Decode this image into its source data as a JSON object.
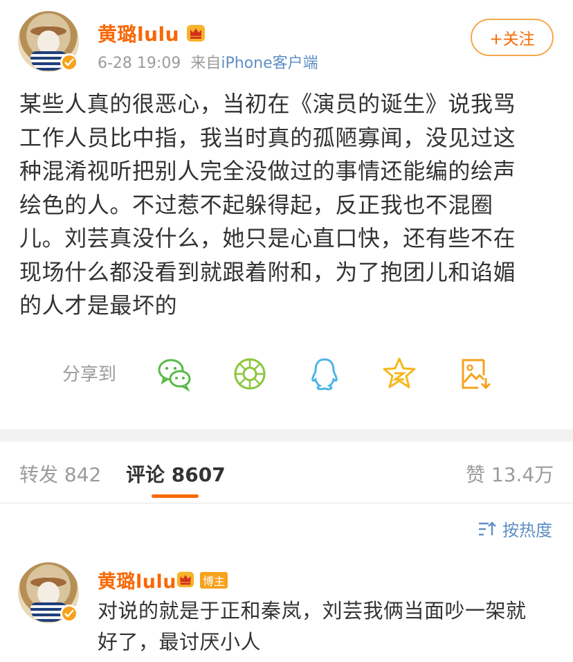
{
  "post": {
    "username": "黄璐lulu",
    "time": "6-28 19:09",
    "source_prefix": "来自",
    "source": "iPhone客户端",
    "follow_label": "+关注",
    "lines": [
      "某些人真的很恶心，当初在《演员的诞生》说我骂",
      "工作人员比中指，我当时真的孤陋寡闻，没见过这",
      "种混淆视听把别人完全没做过的事情还能编的绘声",
      "绘色的人。不过惹不起躲得起，反正我也不混圈",
      "儿。刘芸真没什么，她只是心直口快，还有些不在",
      "现场什么都没看到就跟着附和，为了抱团儿和谄媚",
      "的人才是最坏的"
    ]
  },
  "share": {
    "label": "分享到",
    "icons": [
      "wechat-icon",
      "moments-icon",
      "qq-icon",
      "qzone-icon",
      "save-image-icon"
    ]
  },
  "tabs": {
    "repost": "转发 842",
    "comments": "评论 8607",
    "likes": "赞 13.4万"
  },
  "sort": {
    "label": "按热度"
  },
  "comment": {
    "username": "黄璐lulu",
    "tag": "博主",
    "lines": [
      "对说的就是于正和秦岚，刘芸我俩当面吵一架就",
      "好了，最讨厌小人"
    ]
  },
  "colors": {
    "username": "#f86806",
    "link": "#5f8ec4",
    "muted": "#9b9b9b",
    "accent": "#f6a21c"
  }
}
